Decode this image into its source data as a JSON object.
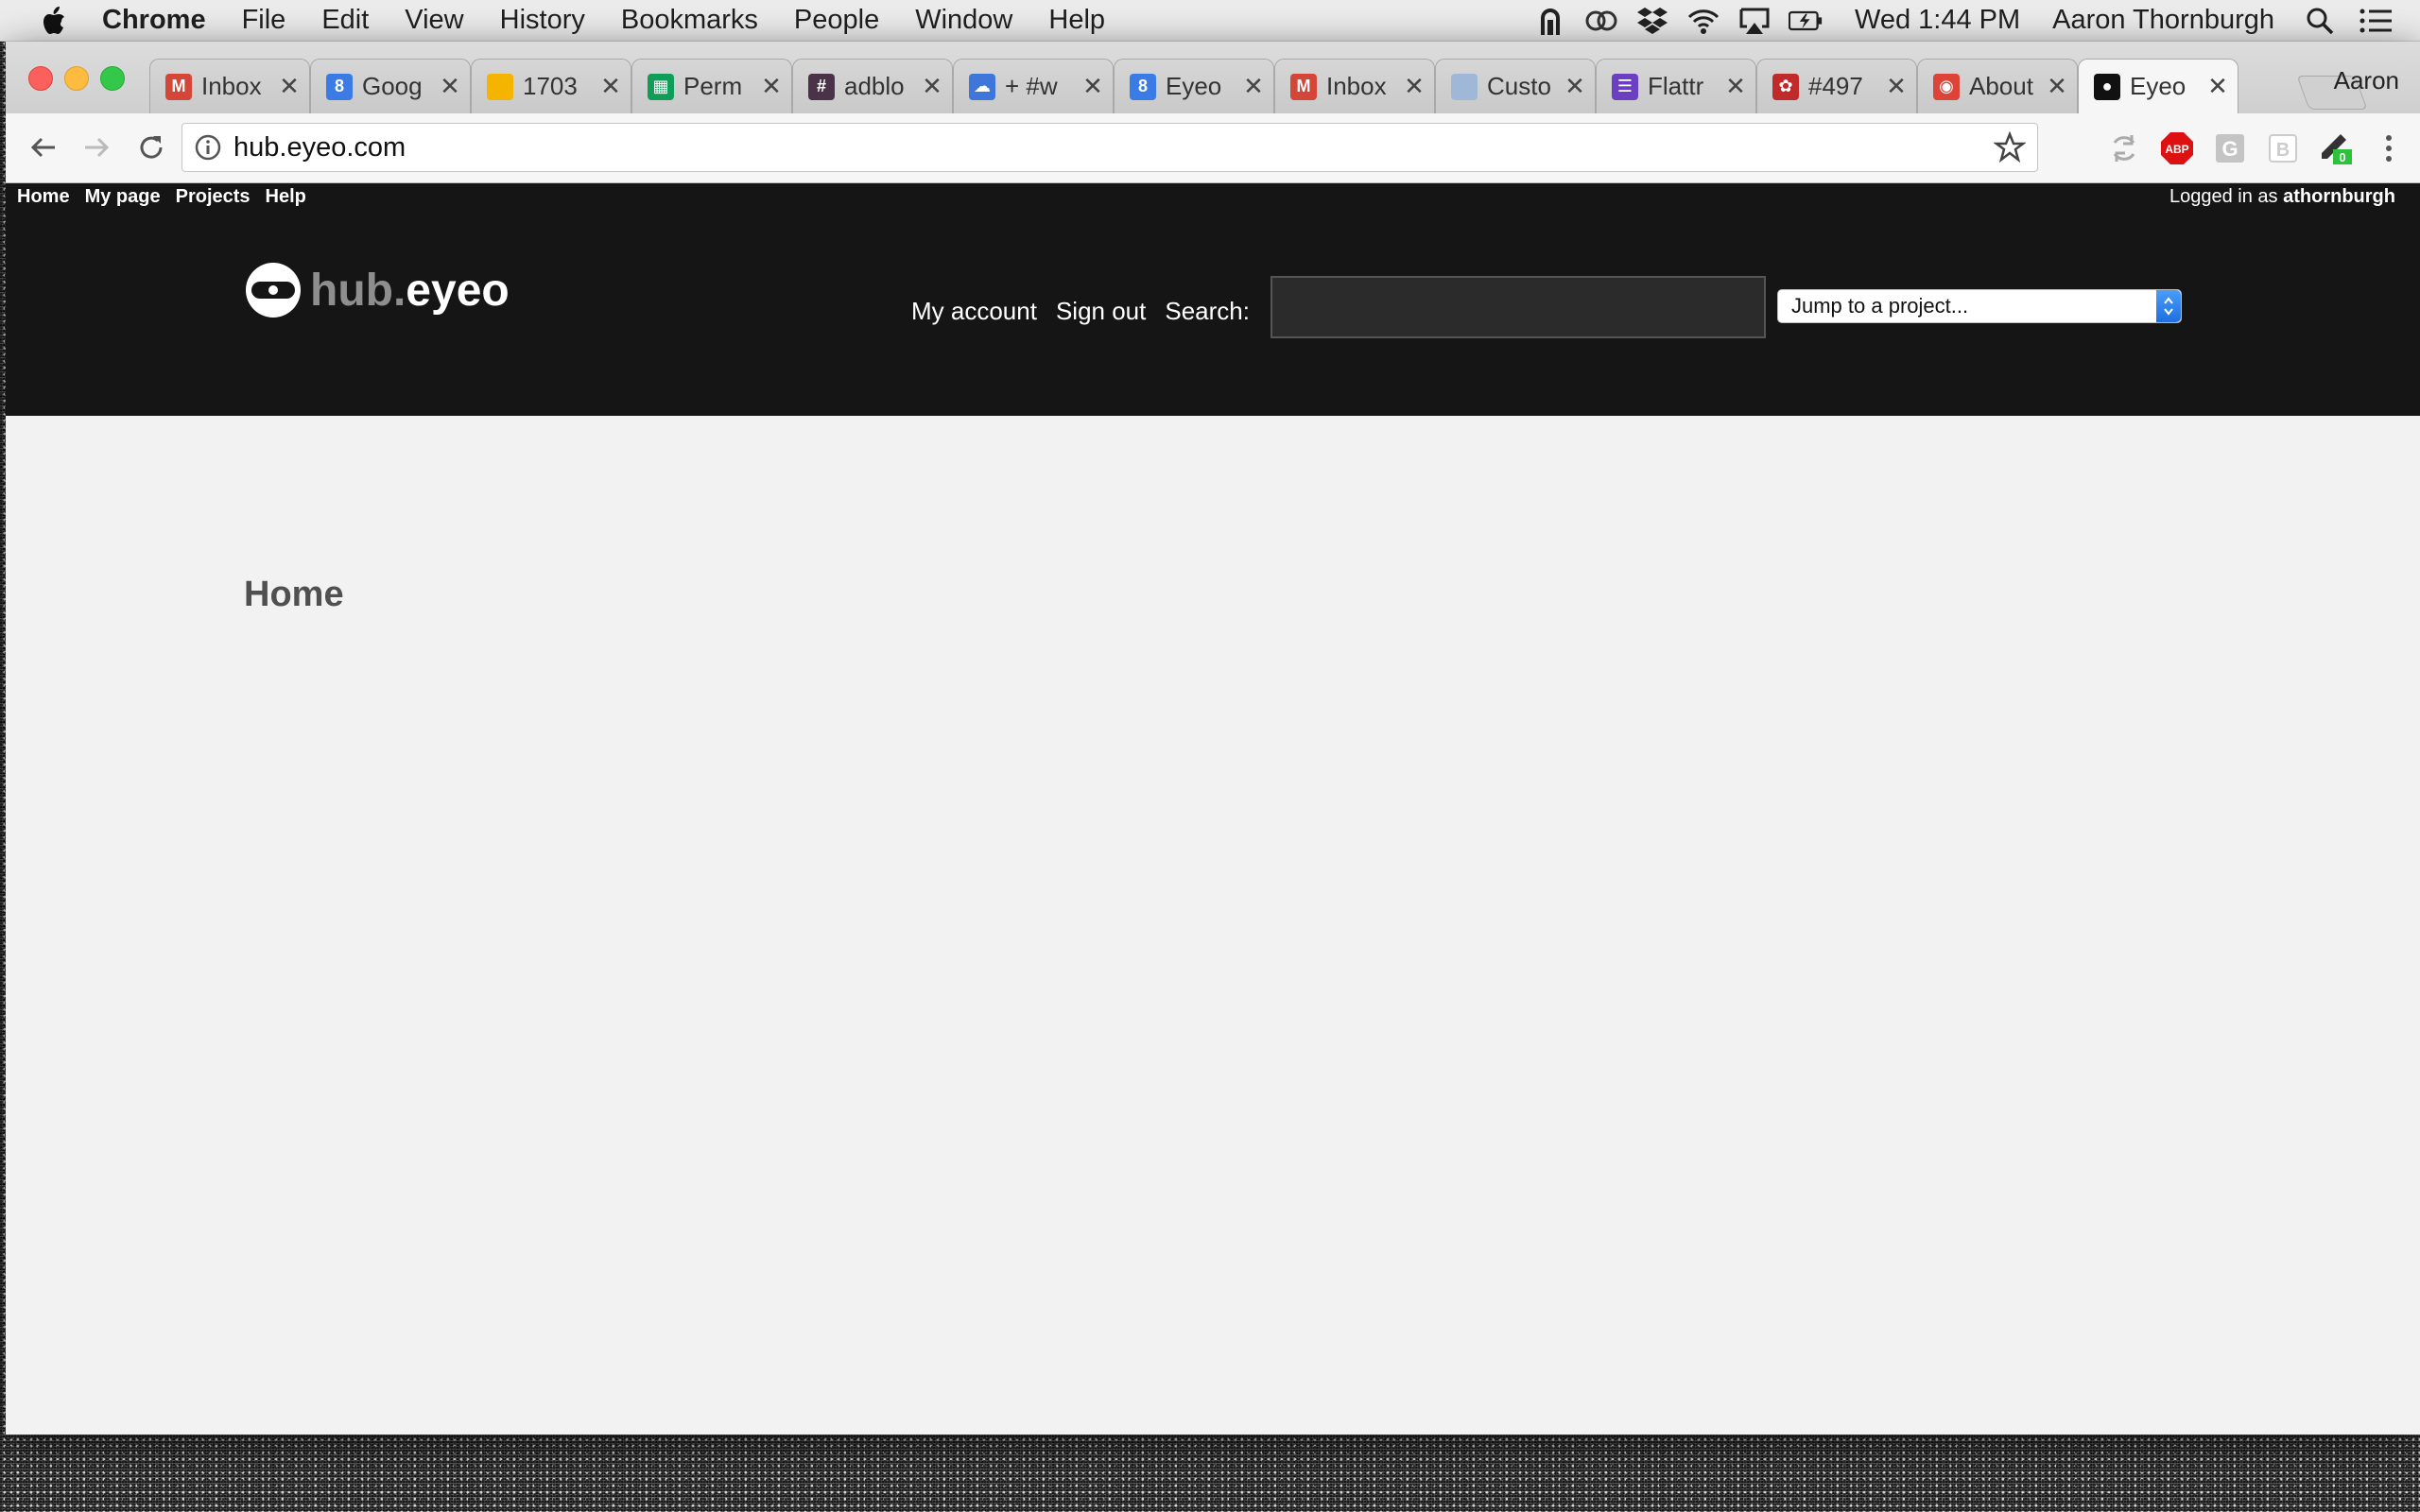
{
  "menubar": {
    "app": "Chrome",
    "items": [
      "File",
      "Edit",
      "View",
      "History",
      "Bookmarks",
      "People",
      "Window",
      "Help"
    ],
    "clock": "Wed 1:44 PM",
    "user": "Aaron Thornburgh"
  },
  "tabs": [
    {
      "label": "Inbox",
      "icon": "gmail-icon",
      "color": "#d44638",
      "glyph": "M"
    },
    {
      "label": "Goog",
      "icon": "calendar-icon",
      "color": "#3b7be6",
      "glyph": "8"
    },
    {
      "label": "1703",
      "icon": "slides-icon",
      "color": "#f4b400",
      "glyph": ""
    },
    {
      "label": "Perm",
      "icon": "sheets-icon",
      "color": "#0f9d58",
      "glyph": "▦"
    },
    {
      "label": "adblo",
      "icon": "slack-icon",
      "color": "#4a3349",
      "glyph": "#"
    },
    {
      "label": "+ #w",
      "icon": "cloud-icon",
      "color": "#3f76d9",
      "glyph": "☁"
    },
    {
      "label": "Eyeo",
      "icon": "calendar-icon",
      "color": "#3b7be6",
      "glyph": "8"
    },
    {
      "label": "Inbox",
      "icon": "gmail-icon",
      "color": "#d44638",
      "glyph": "M"
    },
    {
      "label": "Custo",
      "icon": "doc-icon",
      "color": "#9fb8d8",
      "glyph": ""
    },
    {
      "label": "Flattr",
      "icon": "list-icon",
      "color": "#6a3fc2",
      "glyph": "☰"
    },
    {
      "label": "#497",
      "icon": "paw-icon",
      "color": "#c02a2a",
      "glyph": "✿"
    },
    {
      "label": "About",
      "icon": "chrome-icon",
      "color": "#db4437",
      "glyph": "◉"
    },
    {
      "label": "Eyeo",
      "icon": "eyeo-icon",
      "color": "#111111",
      "glyph": "●",
      "active": true
    }
  ],
  "profile": "Aaron",
  "omnibox": {
    "url": "hub.eyeo.com"
  },
  "topmenu": {
    "items": [
      "Home",
      "My page",
      "Projects",
      "Help"
    ],
    "logged_prefix": "Logged in as",
    "logged_user": "athornburgh"
  },
  "header": {
    "logo_hub": "hub.",
    "logo_eyeo": "eyeo",
    "quick": [
      "My account",
      "Sign out",
      "Search:"
    ],
    "jump": "Jump to a project..."
  },
  "main": {
    "title": "Home"
  },
  "extensions": {
    "abp": "ABP",
    "g": "G",
    "b": "B",
    "badge": "0"
  }
}
